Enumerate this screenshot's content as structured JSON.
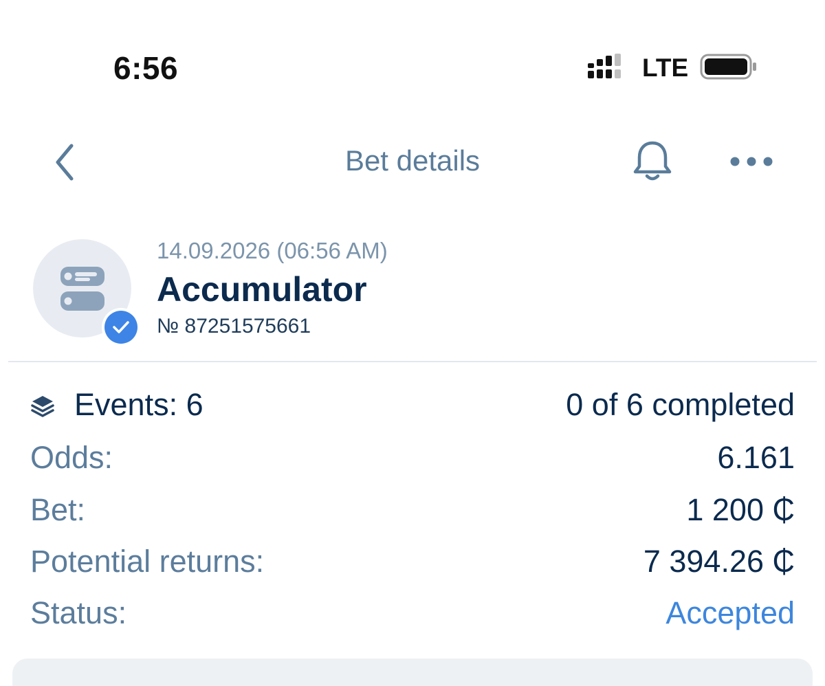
{
  "status_bar": {
    "time": "6:56",
    "network": "LTE"
  },
  "nav": {
    "title": "Bet details",
    "icons": [
      "chevron-left-icon",
      "bell-icon",
      "more-horizontal-icon"
    ]
  },
  "bet": {
    "date": "14.09.2026 (06:56 AM)",
    "type": "Accumulator",
    "number": "№ 87251575661",
    "events_label": "Events: 6",
    "completed": "0 of 6 completed",
    "details": [
      {
        "label": "Odds:",
        "value": "6.161"
      },
      {
        "label": "Bet:",
        "value": "1 200 ₵"
      },
      {
        "label": "Potential returns:",
        "value": "7 394.26 ₵"
      },
      {
        "label": "Status:",
        "value": "Accepted"
      }
    ]
  },
  "colors": {
    "accent": "#3d84e6",
    "title_text": "#5a7c9a",
    "primary_text": "#0b2a4e",
    "label_text": "#5c7d9c",
    "status_accepted": "#3d86dd"
  }
}
